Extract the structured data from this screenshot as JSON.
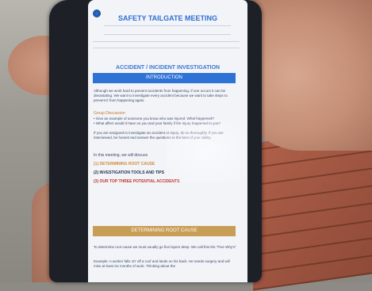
{
  "document": {
    "title": "SAFETY TAILGATE MEETING",
    "section_title": "ACCIDENT / INCIDENT INVESTIGATION",
    "intro_banner": "INTRODUCTION",
    "intro_text": "Although we work hard to prevent accidents from happening, if one occurs it can be devastating. We want to investigate every accident because we want to take steps to prevent it from happening again.",
    "group_discussion_label": "Group Discussion:",
    "discussion_bullets": [
      "Give an example of someone you know who was injured. What happened?",
      "What affect would it have on you and your family if the injury happened to you?"
    ],
    "assigned_text": "If you are assigned to investigate an accident or injury, do so thoroughly. If you are interviewed, be honest and answer the questions to the best of your ability.",
    "we_will_discuss": "In this meeting, we will discuss",
    "topics": [
      "(1) DETERMINING ROOT CAUSE",
      "(2) INVESTIGATION TOOLS AND TIPS",
      "(3) OUR TOP THREE POTENTIAL ACCIDENTS"
    ],
    "root_cause_banner": "DETERMINING ROOT CAUSE",
    "root_cause_text": "To determine root cause we must usually go five layers deep. We call this the \"Five Why's\"",
    "example_text": "Example: A worker falls 10' off a roof and lands on his back. He needs surgery and will miss at least six months of work. Thinking about the"
  },
  "colors": {
    "title_blue": "#2f6fd2",
    "banner_blue": "#2f72d6",
    "banner_gold": "#c89d55",
    "topic_orange": "#d28a3a",
    "topic_red": "#c0362c"
  }
}
